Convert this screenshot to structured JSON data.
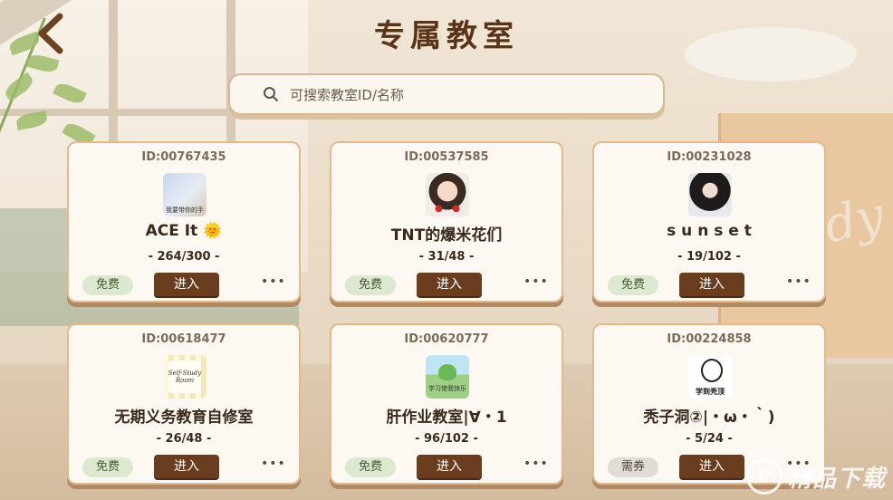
{
  "header": {
    "back_icon": "chevron-left-icon",
    "title": "专属教室"
  },
  "search": {
    "placeholder": "可搜索教室ID/名称",
    "icon": "search-icon"
  },
  "rooms": [
    {
      "id": "ID:00767435",
      "name": "ACE It 🌞",
      "count": "- 264/300 -",
      "tag": "免费",
      "enter": "进入",
      "more": "•••",
      "avatar_caption": "我要带你的手"
    },
    {
      "id": "ID:00537585",
      "name": "TNT的爆米花们",
      "count": "- 31/48 -",
      "tag": "免费",
      "enter": "进入",
      "more": "•••",
      "avatar_caption": ""
    },
    {
      "id": "ID:00231028",
      "name": "s u n s e t",
      "count": "- 19/102 -",
      "tag": "免费",
      "enter": "进入",
      "more": "•••",
      "avatar_caption": ""
    },
    {
      "id": "ID:00618477",
      "name": "无期义务教育自修室",
      "count": "- 26/48 -",
      "tag": "免费",
      "enter": "进入",
      "more": "•••",
      "avatar_caption": "Self-Study Room"
    },
    {
      "id": "ID:00620777",
      "name": "肝作业教室|∀・1",
      "count": "- 96/102 -",
      "tag": "免费",
      "enter": "进入",
      "more": "•••",
      "avatar_caption": "学习使我快乐"
    },
    {
      "id": "ID:00224858",
      "name": "秃子洞②|・ω・｀)",
      "count": "- 5/24 -",
      "tag": "需券",
      "enter": "进入",
      "more": "•••",
      "avatar_caption": "学到秃顶"
    }
  ],
  "watermark": {
    "logo": "P",
    "text": "精品下载"
  },
  "colors": {
    "title": "#5a3418",
    "enter_button": "#6a3d1f",
    "card_border": "#e4b98c",
    "free_tag_bg": "#dce8cf",
    "paid_tag_bg": "#e1dcd6"
  }
}
